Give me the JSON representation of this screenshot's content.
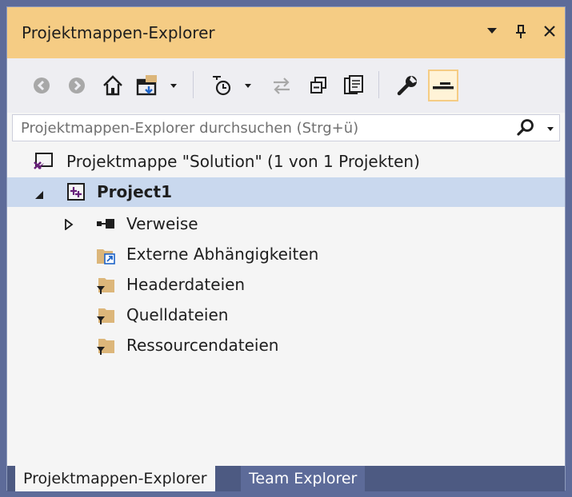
{
  "window": {
    "title": "Projektmappen-Explorer"
  },
  "toolbar": {
    "items": [
      {
        "name": "back-icon"
      },
      {
        "name": "forward-icon"
      },
      {
        "name": "home-icon"
      },
      {
        "name": "switch-views-icon"
      },
      {
        "name": "pending-changes-filter-icon"
      },
      {
        "name": "sync-icon"
      },
      {
        "name": "collapse-all-icon"
      },
      {
        "name": "show-all-files-icon"
      },
      {
        "name": "properties-icon"
      },
      {
        "name": "preview-icon",
        "pressed": true
      }
    ]
  },
  "search": {
    "placeholder": "Projektmappen-Explorer durchsuchen (Strg+ü)"
  },
  "tree": {
    "solution": "Projektmappe \"Solution\" (1 von 1 Projekten)",
    "project": "Project1",
    "items": [
      {
        "label": "Verweise",
        "icon": "references-icon"
      },
      {
        "label": "Externe Abhängigkeiten",
        "icon": "external-dependencies-icon"
      },
      {
        "label": "Headerdateien",
        "icon": "filter-folder-icon"
      },
      {
        "label": "Quelldateien",
        "icon": "filter-folder-icon"
      },
      {
        "label": "Ressourcendateien",
        "icon": "filter-folder-icon"
      }
    ]
  },
  "tabs": [
    {
      "label": "Projektmappen-Explorer",
      "active": true
    },
    {
      "label": "Team Explorer",
      "active": false
    }
  ],
  "colors": {
    "background": "#5d6b99",
    "title_bar": "#f5cc84",
    "selection": "#c9d8ee",
    "folder": "#dcb67a"
  }
}
